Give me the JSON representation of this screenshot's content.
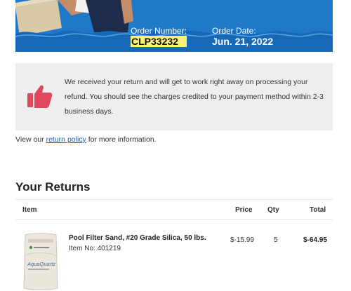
{
  "header": {
    "order_number_label": "Order Number:",
    "order_number": "CLP33232",
    "order_date_label": "Order Date:",
    "order_date": "Jun. 21, 2022",
    "banner_color": "#1f78c8"
  },
  "notice": {
    "icon": "thumbs-up-icon",
    "icon_color": "#e0485c",
    "message": "We received your return and will get to work right away on processing your refund. You should see the charges credited to your payment method within 2-3 business days."
  },
  "policy": {
    "prefix": "View our",
    "link_text": "return policy",
    "suffix": "for more information."
  },
  "returns": {
    "title": "Your Returns",
    "columns": {
      "item": "Item",
      "price": "Price",
      "qty": "Qty",
      "total": "Total"
    },
    "rows": [
      {
        "name": "Pool Filter Sand, #20 Grade Silica, 50 lbs.",
        "item_no": "Item No: 401219",
        "price": "$-15.99",
        "qty": "5",
        "total": "$-64.95",
        "image_label": "AquaQuartz"
      }
    ]
  }
}
